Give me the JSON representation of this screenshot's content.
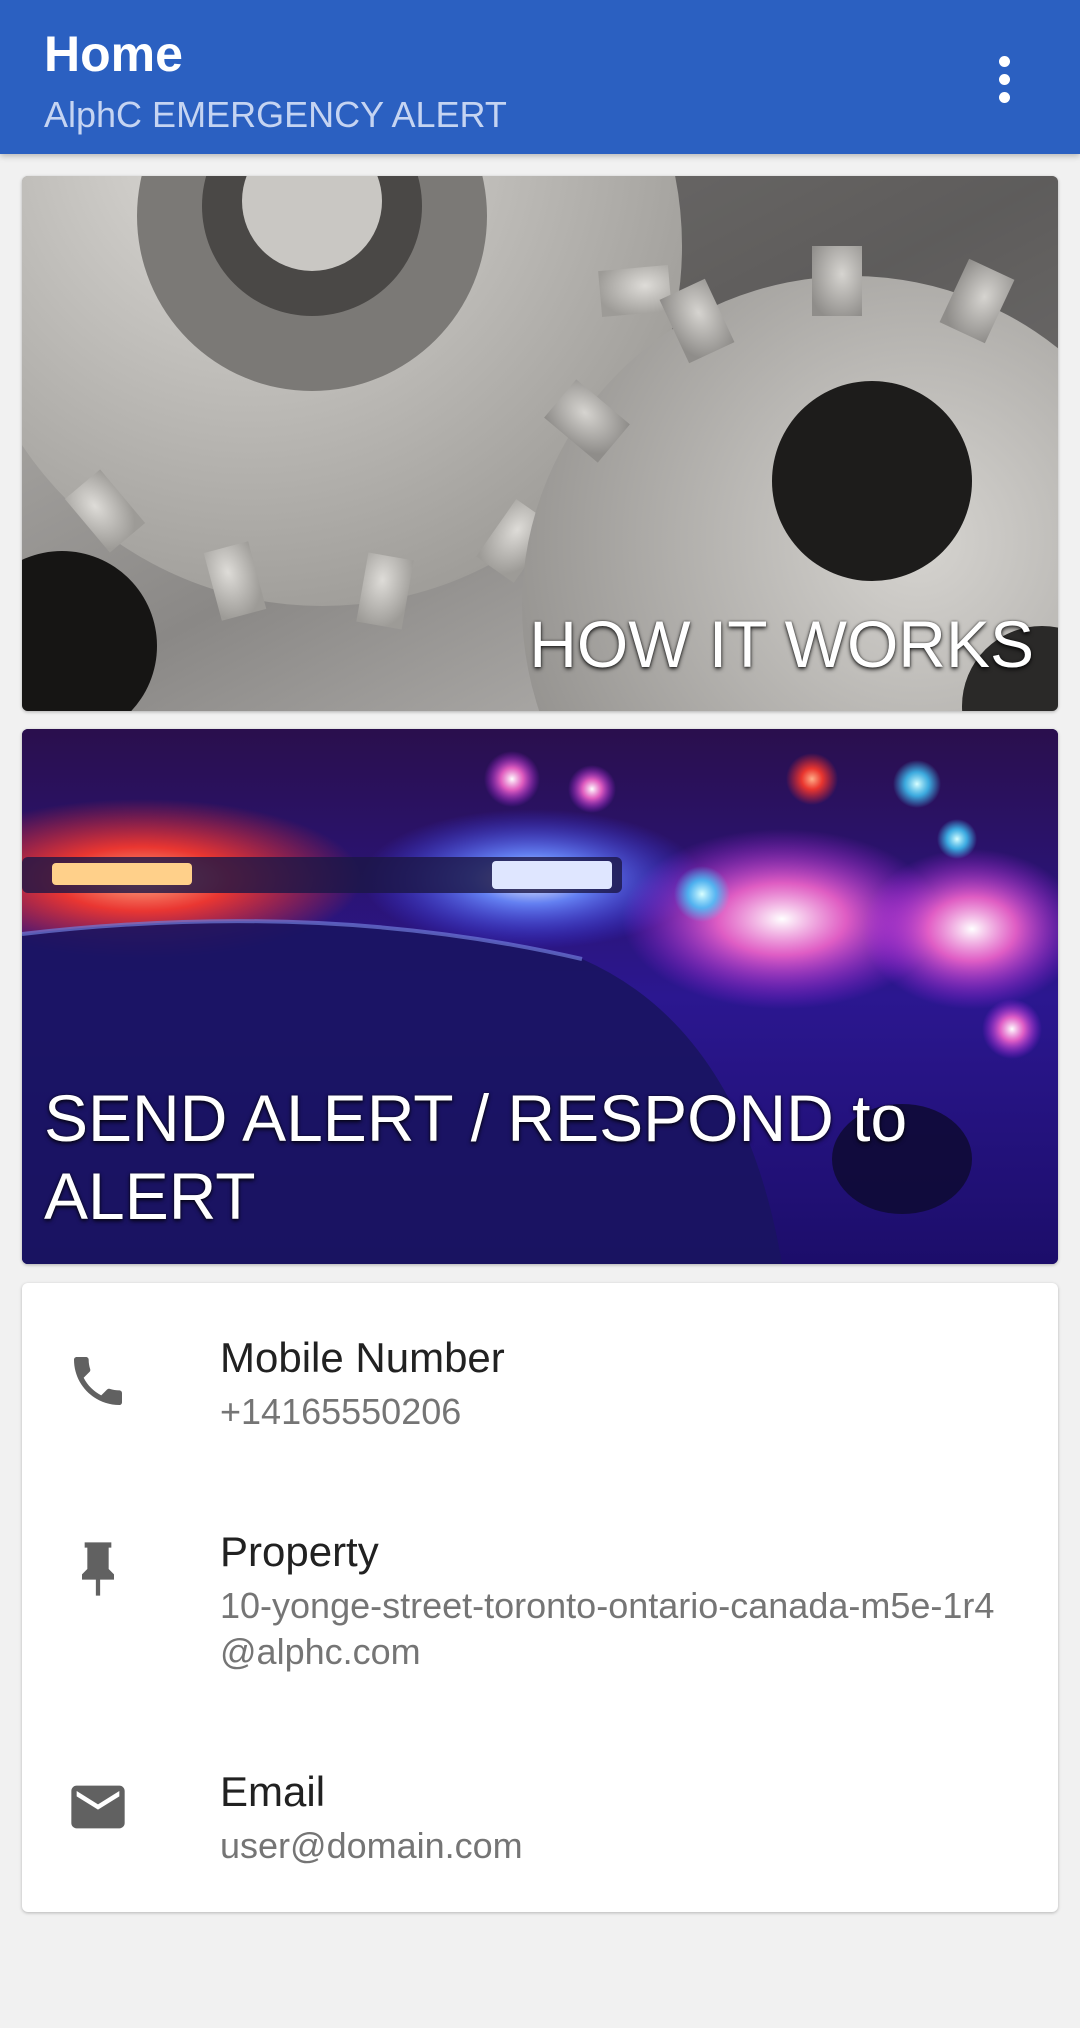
{
  "appbar": {
    "title": "Home",
    "subtitle": "AlphC EMERGENCY ALERT",
    "menu_icon": "more-vert-icon"
  },
  "cards": {
    "how_it_works": {
      "label": "HOW IT WORKS",
      "image": "gears-photo"
    },
    "send_alert": {
      "label": "SEND ALERT / RESPOND to ALERT",
      "image": "police-lights-photo"
    }
  },
  "details": {
    "mobile": {
      "icon": "phone-icon",
      "title": "Mobile Number",
      "value": "+14165550206"
    },
    "property": {
      "icon": "pin-icon",
      "title": "Property",
      "value": "10-yonge-street-toronto-ontario-canada-m5e-1r4@alphc.com"
    },
    "email": {
      "icon": "mail-icon",
      "title": "Email",
      "value": "user@domain.com"
    }
  },
  "colors": {
    "primary": "#2b60c1",
    "background": "#f1f1f1",
    "text_primary": "#212121",
    "text_secondary": "#757575"
  }
}
